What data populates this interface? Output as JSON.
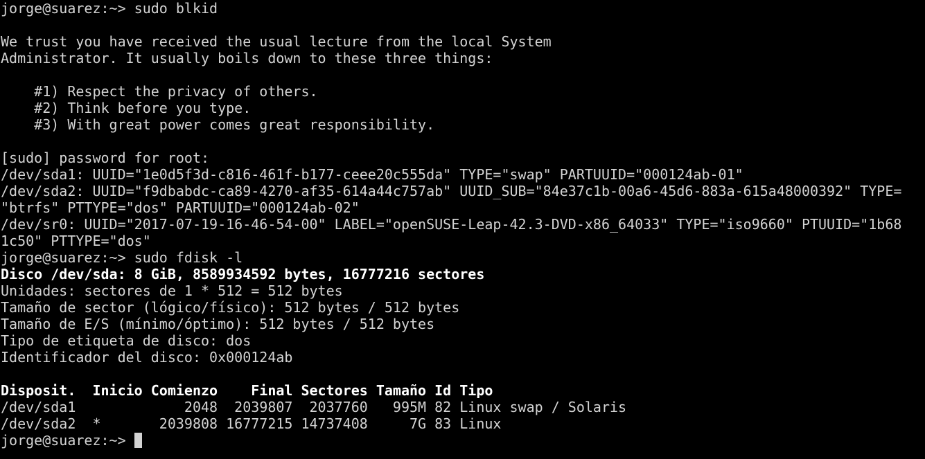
{
  "terminal": {
    "lines": [
      {
        "text": "jorge@suarez:~> sudo blkid",
        "bold": false
      },
      {
        "text": "",
        "bold": false
      },
      {
        "text": "We trust you have received the usual lecture from the local System",
        "bold": false
      },
      {
        "text": "Administrator. It usually boils down to these three things:",
        "bold": false
      },
      {
        "text": "",
        "bold": false
      },
      {
        "text": "    #1) Respect the privacy of others.",
        "bold": false
      },
      {
        "text": "    #2) Think before you type.",
        "bold": false
      },
      {
        "text": "    #3) With great power comes great responsibility.",
        "bold": false
      },
      {
        "text": "",
        "bold": false
      },
      {
        "text": "[sudo] password for root:",
        "bold": false
      },
      {
        "text": "/dev/sda1: UUID=\"1e0d5f3d-c816-461f-b177-ceee20c555da\" TYPE=\"swap\" PARTUUID=\"000124ab-01\"",
        "bold": false
      },
      {
        "text": "/dev/sda2: UUID=\"f9dbabdc-ca89-4270-af35-614a44c757ab\" UUID_SUB=\"84e37c1b-00a6-45d6-883a-615a48000392\" TYPE=",
        "bold": false
      },
      {
        "text": "\"btrfs\" PTTYPE=\"dos\" PARTUUID=\"000124ab-02\"",
        "bold": false
      },
      {
        "text": "/dev/sr0: UUID=\"2017-07-19-16-46-54-00\" LABEL=\"openSUSE-Leap-42.3-DVD-x86_64033\" TYPE=\"iso9660\" PTUUID=\"1b68",
        "bold": false
      },
      {
        "text": "1c50\" PTTYPE=\"dos\"",
        "bold": false
      },
      {
        "text": "jorge@suarez:~> sudo fdisk -l",
        "bold": false
      },
      {
        "text": "Disco /dev/sda: 8 GiB, 8589934592 bytes, 16777216 sectores",
        "bold": true
      },
      {
        "text": "Unidades: sectores de 1 * 512 = 512 bytes",
        "bold": false
      },
      {
        "text": "Tamaño de sector (lógico/físico): 512 bytes / 512 bytes",
        "bold": false
      },
      {
        "text": "Tamaño de E/S (mínimo/óptimo): 512 bytes / 512 bytes",
        "bold": false
      },
      {
        "text": "Tipo de etiqueta de disco: dos",
        "bold": false
      },
      {
        "text": "Identificador del disco: 0x000124ab",
        "bold": false
      },
      {
        "text": "",
        "bold": false
      },
      {
        "text": "Disposit.  Inicio Comienzo    Final Sectores Tamaño Id Tipo",
        "bold": true
      },
      {
        "text": "/dev/sda1             2048  2039807  2037760   995M 82 Linux swap / Solaris",
        "bold": false
      },
      {
        "text": "/dev/sda2  *       2039808 16777215 14737408     7G 83 Linux",
        "bold": false
      }
    ],
    "prompt": "jorge@suarez:~> "
  }
}
